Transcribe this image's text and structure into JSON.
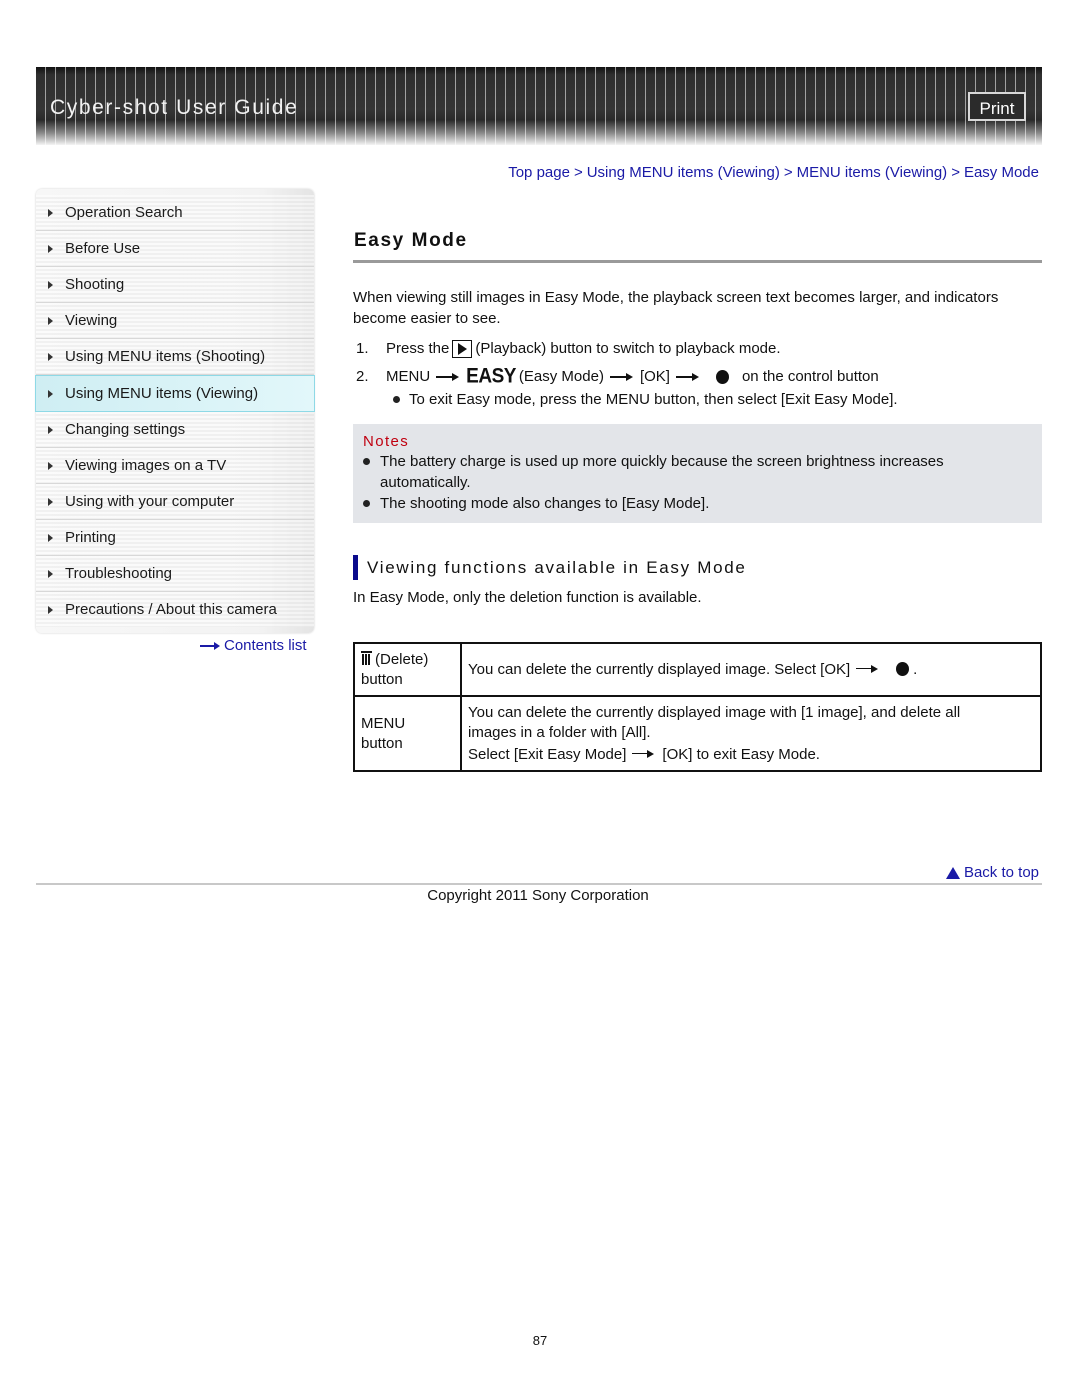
{
  "header": {
    "title": "Cyber-shot User Guide",
    "print_label": "Print"
  },
  "breadcrumb": [
    {
      "label": "Top page"
    },
    {
      "label": "Using MENU items (Viewing)"
    },
    {
      "label": "MENU items (Viewing)"
    },
    {
      "label": "Easy Mode"
    }
  ],
  "breadcrumb_separator": ">",
  "sidebar": {
    "items": [
      {
        "label": "Operation Search",
        "active": false
      },
      {
        "label": "Before Use",
        "active": false
      },
      {
        "label": "Shooting",
        "active": false
      },
      {
        "label": "Viewing",
        "active": false
      },
      {
        "label": "Using MENU items (Shooting)",
        "active": false
      },
      {
        "label": "Using MENU items (Viewing)",
        "active": true
      },
      {
        "label": "Changing settings",
        "active": false
      },
      {
        "label": "Viewing images on a TV",
        "active": false
      },
      {
        "label": "Using with your computer",
        "active": false
      },
      {
        "label": "Printing",
        "active": false
      },
      {
        "label": "Troubleshooting",
        "active": false
      },
      {
        "label": "Precautions / About this camera",
        "active": false
      }
    ],
    "contents_link": "Contents list"
  },
  "main": {
    "title": "Easy Mode",
    "intro": "When viewing still images in Easy Mode, the playback screen text becomes larger, and indicators become easier to see.",
    "steps": [
      {
        "num": "1.",
        "before": "Press the",
        "icon": "playback-icon",
        "after": "(Playback) button to switch to playback mode."
      },
      {
        "num": "2.",
        "menu": "MENU",
        "easy_icon_text": "EASY",
        "easy_label": "(Easy Mode)",
        "ok": "[OK]",
        "tail": "on the control button",
        "sub_bullet": "To exit Easy mode, press the MENU button, then select [Exit Easy Mode]."
      }
    ],
    "notes": {
      "title": "Notes",
      "items": [
        "The battery charge is used up more quickly because the screen brightness increases automatically.",
        "The shooting mode also changes to [Easy Mode]."
      ]
    },
    "section": {
      "title": "Viewing functions available in Easy Mode",
      "intro": "In Easy Mode, only the deletion function is available."
    },
    "table": {
      "rows": [
        {
          "key_icon": "trash-icon",
          "key_label": "(Delete)",
          "key_suffix": "button",
          "value_line1": "You can delete the currently displayed image. Select [OK]",
          "value_end": "."
        },
        {
          "key_label": "MENU",
          "key_suffix": "button",
          "value_line1": "You can delete the currently displayed image with [1 image], and delete all images in a folder with [All].",
          "value_line2_a": "Select [Exit Easy Mode]",
          "value_line2_b": "[OK] to exit Easy Mode."
        }
      ]
    }
  },
  "footer": {
    "back_to_top": "Back to top",
    "copyright": "Copyright 2011 Sony Corporation",
    "page_number": "87"
  },
  "colors": {
    "link": "#1a1aa6",
    "notes_title": "#c00010",
    "notes_bg": "#e3e5e9",
    "section_bar": "#0a0a8c",
    "active_nav_bg": "#d6f2f6"
  }
}
